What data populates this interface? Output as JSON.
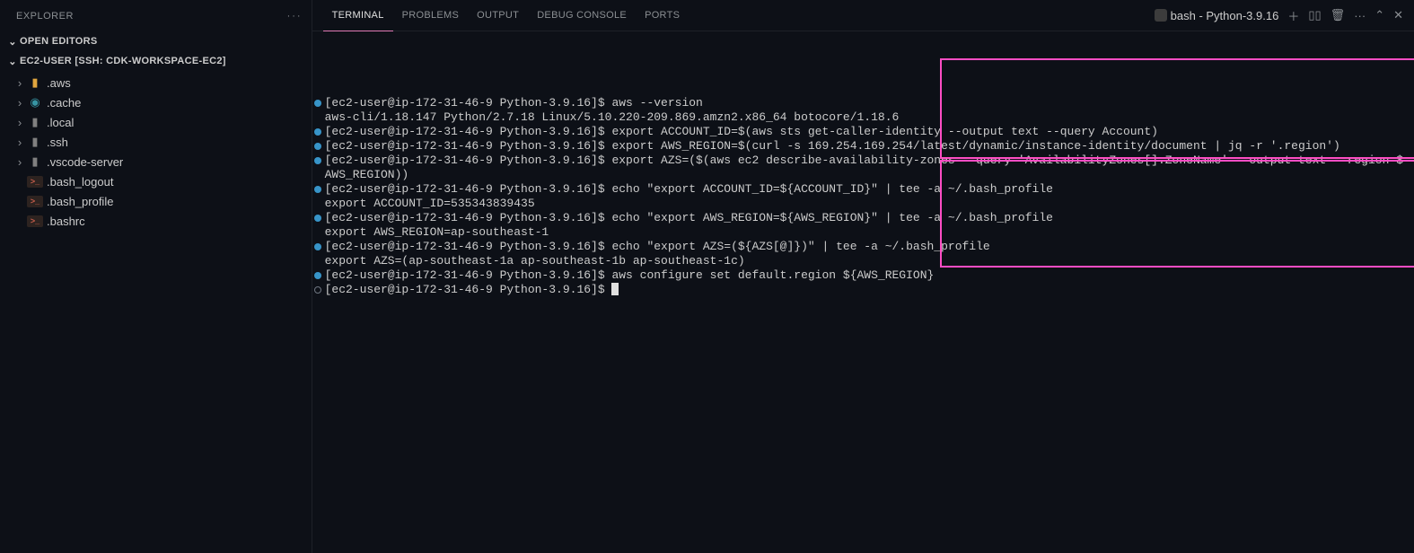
{
  "sidebar": {
    "title": "EXPLORER",
    "more": "···",
    "sections": {
      "openEditors": "OPEN EDITORS",
      "workspace": "EC2-USER [SSH: CDK-WORKSPACE-EC2]"
    },
    "tree": [
      {
        "type": "folder",
        "label": ".aws",
        "iconClass": "aws"
      },
      {
        "type": "folder",
        "label": ".cache",
        "iconClass": "cache"
      },
      {
        "type": "folder",
        "label": ".local",
        "iconClass": ""
      },
      {
        "type": "folder",
        "label": ".ssh",
        "iconClass": ""
      },
      {
        "type": "folder",
        "label": ".vscode-server",
        "iconClass": ""
      },
      {
        "type": "file",
        "label": ".bash_logout"
      },
      {
        "type": "file",
        "label": ".bash_profile"
      },
      {
        "type": "file",
        "label": ".bashrc"
      }
    ]
  },
  "panel": {
    "tabs": [
      "TERMINAL",
      "PROBLEMS",
      "OUTPUT",
      "DEBUG CONSOLE",
      "PORTS"
    ],
    "activeTab": "TERMINAL",
    "shellLabel": "bash - Python-3.9.16"
  },
  "terminal": {
    "prompt": "[ec2-user@ip-172-31-46-9 Python-3.9.16]$",
    "lines": [
      {
        "dot": "solid",
        "prompt": true,
        "cmd": " aws --version"
      },
      {
        "dot": "none",
        "prompt": false,
        "cmd": "aws-cli/1.18.147 Python/2.7.18 Linux/5.10.220-209.869.amzn2.x86_64 botocore/1.18.6"
      },
      {
        "dot": "solid",
        "prompt": true,
        "cmd": " export ACCOUNT_ID=$(aws sts get-caller-identity --output text --query Account)"
      },
      {
        "dot": "solid",
        "prompt": true,
        "cmd": " export AWS_REGION=$(curl -s 169.254.169.254/latest/dynamic/instance-identity/document | jq -r '.region')"
      },
      {
        "dot": "solid",
        "prompt": true,
        "cmd": " export AZS=($(aws ec2 describe-availability-zones --query 'AvailabilityZones[].ZoneName' --output text --region $"
      },
      {
        "dot": "none",
        "prompt": false,
        "cmd": "AWS_REGION))"
      },
      {
        "dot": "solid",
        "prompt": true,
        "cmd": " echo \"export ACCOUNT_ID=${ACCOUNT_ID}\" | tee -a ~/.bash_profile"
      },
      {
        "dot": "none",
        "prompt": false,
        "cmd": "export ACCOUNT_ID=535343839435"
      },
      {
        "dot": "solid",
        "prompt": true,
        "cmd": " echo \"export AWS_REGION=${AWS_REGION}\" | tee -a ~/.bash_profile"
      },
      {
        "dot": "none",
        "prompt": false,
        "cmd": "export AWS_REGION=ap-southeast-1"
      },
      {
        "dot": "solid",
        "prompt": true,
        "cmd": " echo \"export AZS=(${AZS[@]})\" | tee -a ~/.bash_profile"
      },
      {
        "dot": "none",
        "prompt": false,
        "cmd": "export AZS=(ap-southeast-1a ap-southeast-1b ap-southeast-1c)"
      },
      {
        "dot": "solid",
        "prompt": true,
        "cmd": " aws configure set default.region ${AWS_REGION}"
      },
      {
        "dot": "hollow",
        "prompt": true,
        "cmd": " ",
        "cursor": true
      }
    ]
  }
}
